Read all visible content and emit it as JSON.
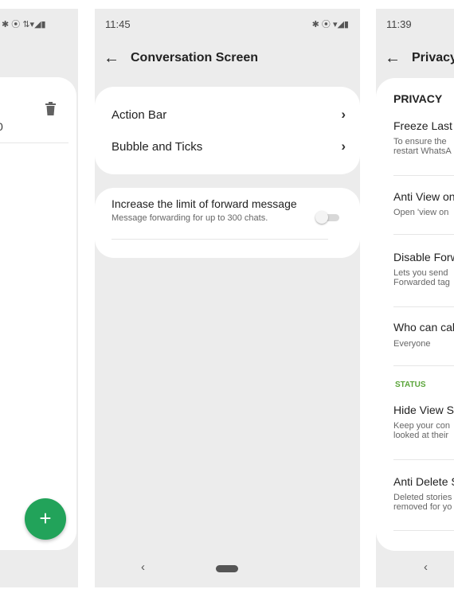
{
  "left_screen": {
    "status_icons": "✱ ⦿ ⇅▾◢▮",
    "digit_fragment": "0",
    "fab_label": "+"
  },
  "middle_screen": {
    "time": "11:45",
    "status_icons": "✱ ⦿ ▾◢▮",
    "title": "Conversation Screen",
    "menu": [
      {
        "label": "Action Bar"
      },
      {
        "label": "Bubble and Ticks"
      }
    ],
    "forward_setting": {
      "title": "Increase the limit of forward message",
      "subtitle": "Message forwarding for up to 300 chats.",
      "enabled": false
    },
    "nav_back": "‹"
  },
  "right_screen": {
    "time": "11:39",
    "title": "Privacy",
    "section_privacy": "PRIVACY",
    "items": [
      {
        "title": "Freeze Last S",
        "sub1": "To ensure the",
        "sub2": "restart WhatsA"
      },
      {
        "title": "Anti View on",
        "sub1": "Open 'view on",
        "sub2": ""
      },
      {
        "title": "Disable Forw",
        "sub1": "Lets you send",
        "sub2": "Forwarded tag"
      },
      {
        "title": "Who can cal",
        "sub1": "Everyone",
        "sub2": ""
      }
    ],
    "section_status": "STATUS",
    "status_items": [
      {
        "title": "Hide View St",
        "sub1": "Keep your con",
        "sub2": "looked at their"
      },
      {
        "title": "Anti Delete S",
        "sub1": "Deleted stories",
        "sub2": "removed for yo"
      }
    ],
    "nav_back": "‹"
  },
  "colors": {
    "background": "#ececec",
    "card": "#ffffff",
    "fab": "#22a35a",
    "status_section": "#5ba53a"
  }
}
